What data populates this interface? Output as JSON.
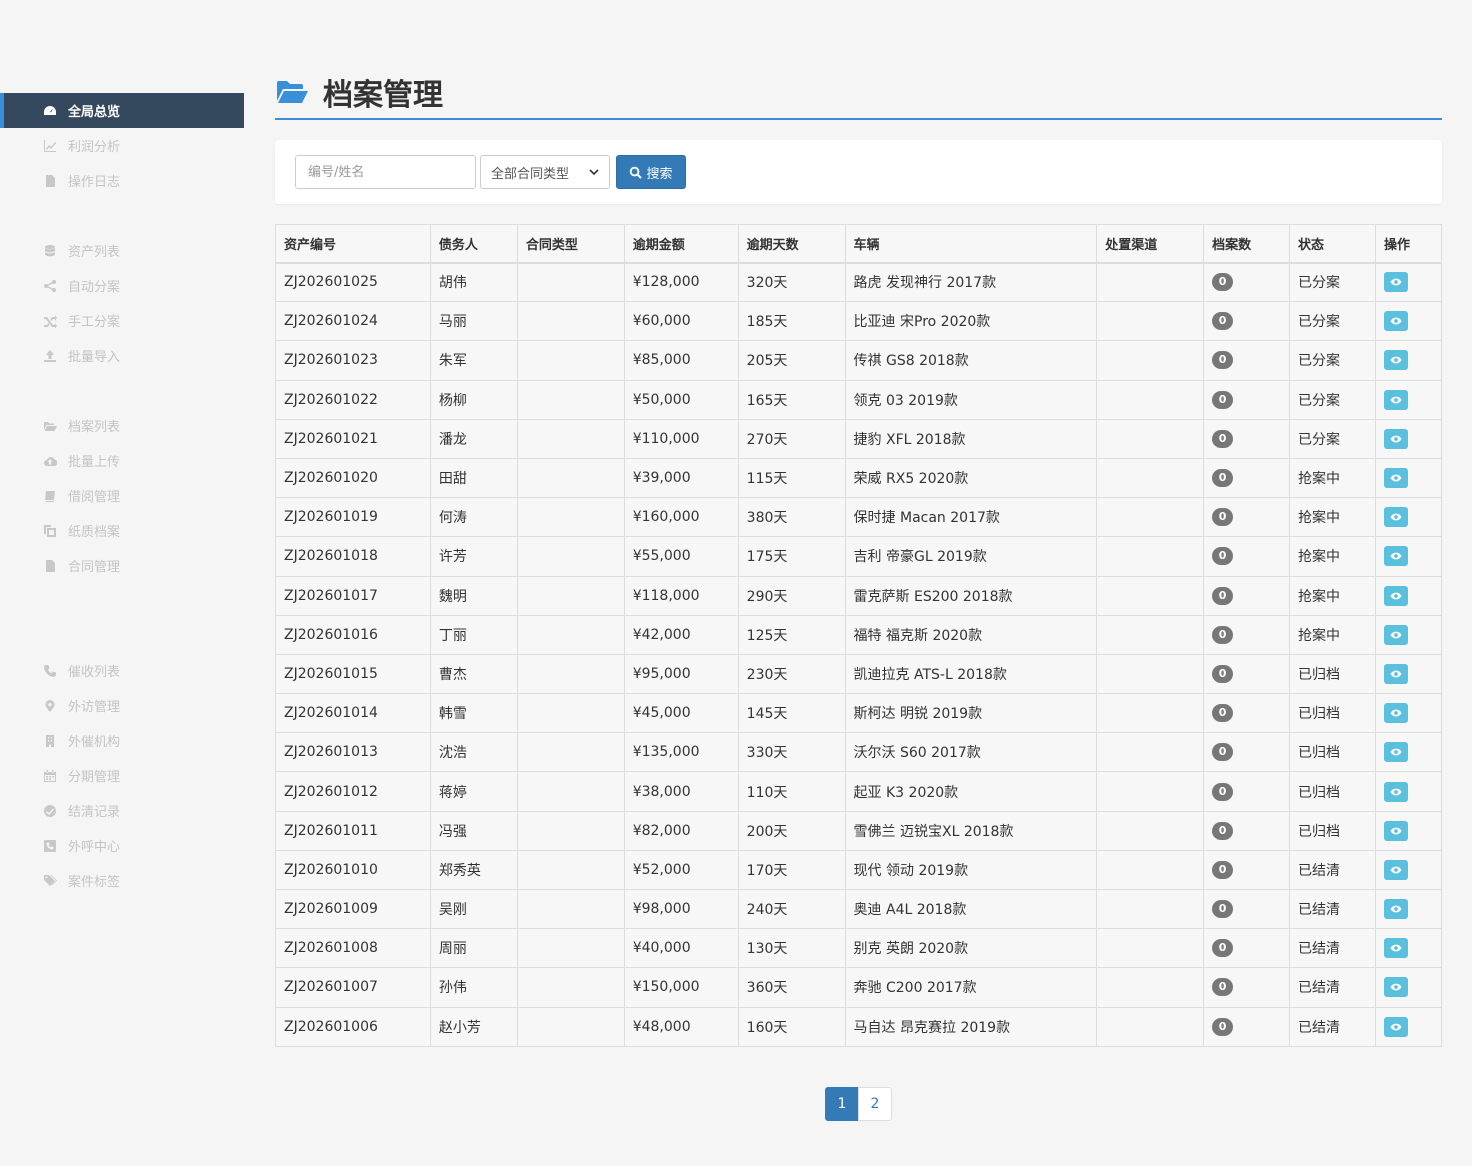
{
  "sidebar": {
    "groups": [
      [
        {
          "label": "全局总览",
          "icon": "dashboard-icon",
          "active": true
        },
        {
          "label": "利润分析",
          "icon": "line-chart-icon"
        },
        {
          "label": "操作日志",
          "icon": "file-icon"
        }
      ],
      [
        {
          "label": "资产列表",
          "icon": "database-icon"
        },
        {
          "label": "自动分案",
          "icon": "share-icon"
        },
        {
          "label": "手工分案",
          "icon": "shuffle-icon"
        },
        {
          "label": "批量导入",
          "icon": "upload-icon"
        }
      ],
      [
        {
          "label": "档案列表",
          "icon": "folder-open-icon"
        },
        {
          "label": "批量上传",
          "icon": "cloud-upload-icon"
        },
        {
          "label": "借阅管理",
          "icon": "book-icon"
        },
        {
          "label": "纸质档案",
          "icon": "copy-icon"
        },
        {
          "label": "合同管理",
          "icon": "file-icon"
        }
      ],
      [
        {
          "label": "催收列表",
          "icon": "phone-icon"
        },
        {
          "label": "外访管理",
          "icon": "map-marker-icon"
        },
        {
          "label": "外催机构",
          "icon": "building-icon"
        },
        {
          "label": "分期管理",
          "icon": "calendar-icon"
        },
        {
          "label": "结清记录",
          "icon": "check-circle-icon"
        },
        {
          "label": "外呼中心",
          "icon": "phone-square-icon"
        },
        {
          "label": "案件标签",
          "icon": "tags-icon"
        }
      ]
    ]
  },
  "header": {
    "title": "档案管理",
    "icon": "folder-open-icon"
  },
  "search": {
    "placeholder": "编号/姓名",
    "value": "",
    "type_selected": "全部合同类型",
    "button_label": "搜索"
  },
  "table": {
    "columns": [
      "资产编号",
      "债务人",
      "合同类型",
      "逾期金额",
      "逾期天数",
      "车辆",
      "处置渠道",
      "档案数",
      "状态",
      "操作"
    ],
    "rows": [
      {
        "id": "ZJ202601025",
        "debtor": "胡伟",
        "contract": "",
        "amount": "¥128,000",
        "days": "320天",
        "vehicle": "路虎 发现神行 2017款",
        "channel": "",
        "files": "0",
        "status": "已分案"
      },
      {
        "id": "ZJ202601024",
        "debtor": "马丽",
        "contract": "",
        "amount": "¥60,000",
        "days": "185天",
        "vehicle": "比亚迪 宋Pro 2020款",
        "channel": "",
        "files": "0",
        "status": "已分案"
      },
      {
        "id": "ZJ202601023",
        "debtor": "朱军",
        "contract": "",
        "amount": "¥85,000",
        "days": "205天",
        "vehicle": "传祺 GS8 2018款",
        "channel": "",
        "files": "0",
        "status": "已分案"
      },
      {
        "id": "ZJ202601022",
        "debtor": "杨柳",
        "contract": "",
        "amount": "¥50,000",
        "days": "165天",
        "vehicle": "领克 03 2019款",
        "channel": "",
        "files": "0",
        "status": "已分案"
      },
      {
        "id": "ZJ202601021",
        "debtor": "潘龙",
        "contract": "",
        "amount": "¥110,000",
        "days": "270天",
        "vehicle": "捷豹 XFL 2018款",
        "channel": "",
        "files": "0",
        "status": "已分案"
      },
      {
        "id": "ZJ202601020",
        "debtor": "田甜",
        "contract": "",
        "amount": "¥39,000",
        "days": "115天",
        "vehicle": "荣威 RX5 2020款",
        "channel": "",
        "files": "0",
        "status": "抢案中"
      },
      {
        "id": "ZJ202601019",
        "debtor": "何涛",
        "contract": "",
        "amount": "¥160,000",
        "days": "380天",
        "vehicle": "保时捷 Macan 2017款",
        "channel": "",
        "files": "0",
        "status": "抢案中"
      },
      {
        "id": "ZJ202601018",
        "debtor": "许芳",
        "contract": "",
        "amount": "¥55,000",
        "days": "175天",
        "vehicle": "吉利 帝豪GL 2019款",
        "channel": "",
        "files": "0",
        "status": "抢案中"
      },
      {
        "id": "ZJ202601017",
        "debtor": "魏明",
        "contract": "",
        "amount": "¥118,000",
        "days": "290天",
        "vehicle": "雷克萨斯 ES200 2018款",
        "channel": "",
        "files": "0",
        "status": "抢案中"
      },
      {
        "id": "ZJ202601016",
        "debtor": "丁丽",
        "contract": "",
        "amount": "¥42,000",
        "days": "125天",
        "vehicle": "福特 福克斯 2020款",
        "channel": "",
        "files": "0",
        "status": "抢案中"
      },
      {
        "id": "ZJ202601015",
        "debtor": "曹杰",
        "contract": "",
        "amount": "¥95,000",
        "days": "230天",
        "vehicle": "凯迪拉克 ATS-L 2018款",
        "channel": "",
        "files": "0",
        "status": "已归档"
      },
      {
        "id": "ZJ202601014",
        "debtor": "韩雪",
        "contract": "",
        "amount": "¥45,000",
        "days": "145天",
        "vehicle": "斯柯达 明锐 2019款",
        "channel": "",
        "files": "0",
        "status": "已归档"
      },
      {
        "id": "ZJ202601013",
        "debtor": "沈浩",
        "contract": "",
        "amount": "¥135,000",
        "days": "330天",
        "vehicle": "沃尔沃 S60 2017款",
        "channel": "",
        "files": "0",
        "status": "已归档"
      },
      {
        "id": "ZJ202601012",
        "debtor": "蒋婷",
        "contract": "",
        "amount": "¥38,000",
        "days": "110天",
        "vehicle": "起亚 K3 2020款",
        "channel": "",
        "files": "0",
        "status": "已归档"
      },
      {
        "id": "ZJ202601011",
        "debtor": "冯强",
        "contract": "",
        "amount": "¥82,000",
        "days": "200天",
        "vehicle": "雪佛兰 迈锐宝XL 2018款",
        "channel": "",
        "files": "0",
        "status": "已归档"
      },
      {
        "id": "ZJ202601010",
        "debtor": "郑秀英",
        "contract": "",
        "amount": "¥52,000",
        "days": "170天",
        "vehicle": "现代 领动 2019款",
        "channel": "",
        "files": "0",
        "status": "已结清"
      },
      {
        "id": "ZJ202601009",
        "debtor": "吴刚",
        "contract": "",
        "amount": "¥98,000",
        "days": "240天",
        "vehicle": "奥迪 A4L 2018款",
        "channel": "",
        "files": "0",
        "status": "已结清"
      },
      {
        "id": "ZJ202601008",
        "debtor": "周丽",
        "contract": "",
        "amount": "¥40,000",
        "days": "130天",
        "vehicle": "别克 英朗 2020款",
        "channel": "",
        "files": "0",
        "status": "已结清"
      },
      {
        "id": "ZJ202601007",
        "debtor": "孙伟",
        "contract": "",
        "amount": "¥150,000",
        "days": "360天",
        "vehicle": "奔驰 C200 2017款",
        "channel": "",
        "files": "0",
        "status": "已结清"
      },
      {
        "id": "ZJ202601006",
        "debtor": "赵小芳",
        "contract": "",
        "amount": "¥48,000",
        "days": "160天",
        "vehicle": "马自达 昂克赛拉 2019款",
        "channel": "",
        "files": "0",
        "status": "已结清"
      }
    ]
  },
  "pagination": {
    "pages": [
      "1",
      "2"
    ],
    "current": "1"
  },
  "colors": {
    "primary": "#337ab7",
    "accent": "#3a8fd9",
    "sidebar_active": "#34495e",
    "info": "#5bc0de",
    "badge": "#777777"
  }
}
